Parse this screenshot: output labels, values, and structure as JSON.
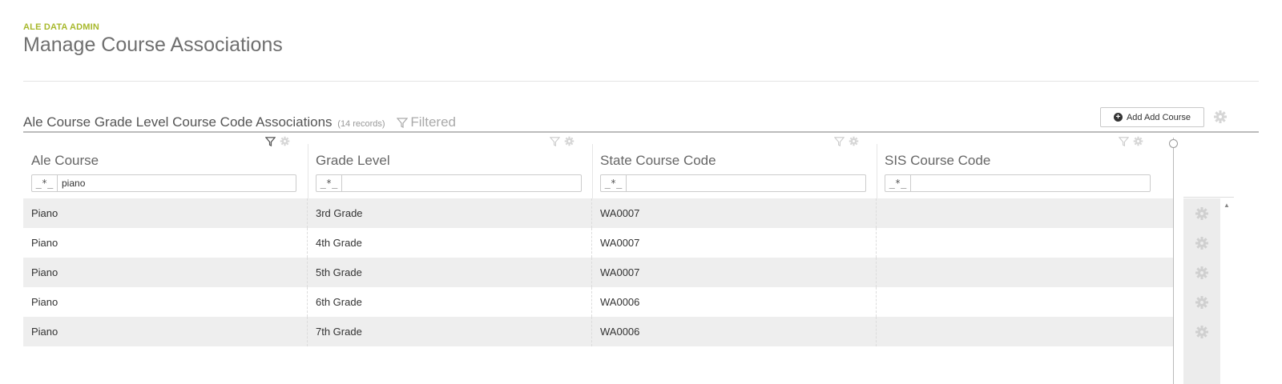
{
  "header": {
    "eyebrow": "ALE DATA ADMIN",
    "title": "Manage Course Associations"
  },
  "grid": {
    "title": "Ale Course Grade Level Course Code Associations",
    "record_count": "(14 records)",
    "filtered_label": "Filtered",
    "add_button_label": "Add Add Course",
    "regex_token": "_*_",
    "columns": [
      {
        "label": "Ale Course",
        "filter_value": "piano",
        "filter_active": true
      },
      {
        "label": "Grade Level",
        "filter_value": "",
        "filter_active": false
      },
      {
        "label": "State Course Code",
        "filter_value": "",
        "filter_active": false
      },
      {
        "label": "SIS Course Code",
        "filter_value": "",
        "filter_active": false
      }
    ],
    "rows": [
      {
        "ale_course": "Piano",
        "grade_level": "3rd Grade",
        "state_course_code": "WA0007",
        "sis_course_code": ""
      },
      {
        "ale_course": "Piano",
        "grade_level": "4th Grade",
        "state_course_code": "WA0007",
        "sis_course_code": ""
      },
      {
        "ale_course": "Piano",
        "grade_level": "5th Grade",
        "state_course_code": "WA0007",
        "sis_course_code": ""
      },
      {
        "ale_course": "Piano",
        "grade_level": "6th Grade",
        "state_course_code": "WA0006",
        "sis_course_code": ""
      },
      {
        "ale_course": "Piano",
        "grade_level": "7th Grade",
        "state_course_code": "WA0006",
        "sis_course_code": ""
      }
    ]
  },
  "icons": {
    "filter": "funnel-icon",
    "settings": "gear-icon",
    "add": "plus-circle-icon"
  },
  "colors": {
    "accent": "#a7b82b",
    "title_text": "#6f6f6f",
    "row_alt": "#eeeeee"
  }
}
